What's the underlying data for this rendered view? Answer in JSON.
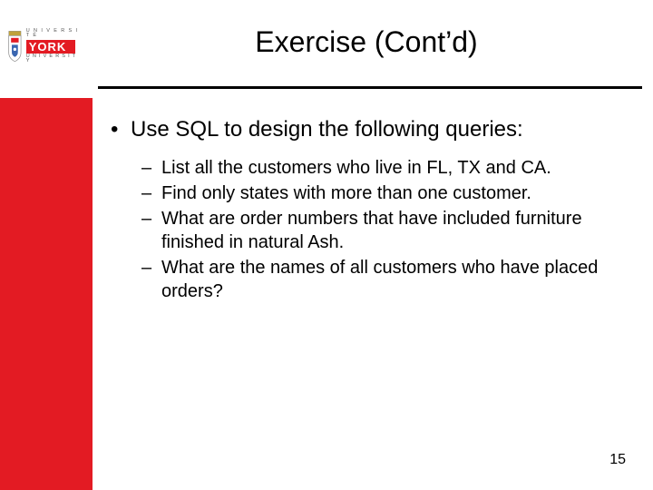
{
  "logo": {
    "top_word": "U N I V E R S I T É",
    "main": "YORK",
    "bottom_word": "U N I V E R S I T Y"
  },
  "title": "Exercise (Cont’d)",
  "main_bullet": "Use SQL to design the following queries:",
  "sub_bullets": [
    "List all the customers who live in FL, TX and CA.",
    "Find only states with more than one customer.",
    "What are order numbers that have included furniture finished in natural Ash.",
    "What are the names of all customers who have placed orders?"
  ],
  "page_number": "15"
}
